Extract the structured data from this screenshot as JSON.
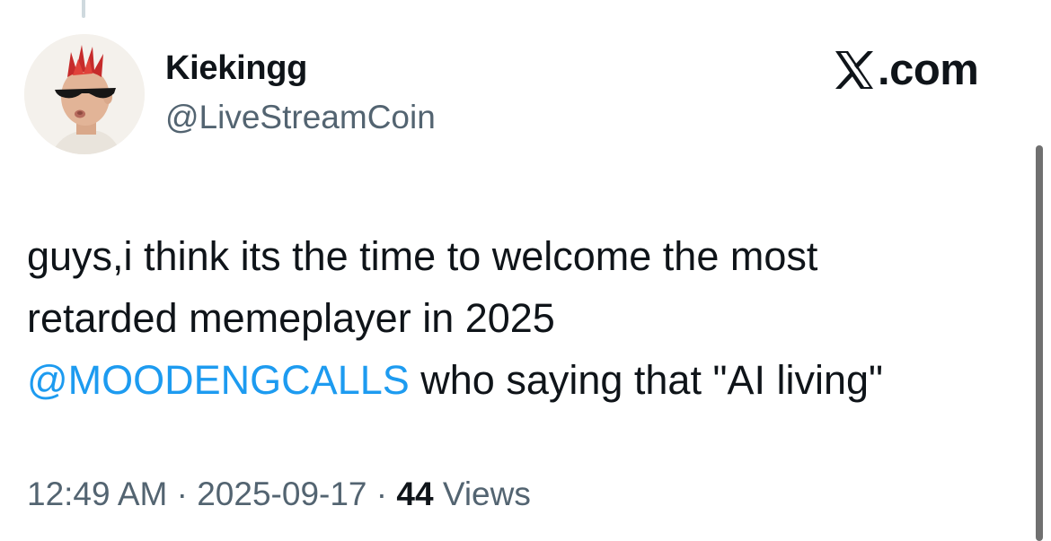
{
  "author": {
    "display_name": "Kiekingg",
    "handle": "@LiveStreamCoin"
  },
  "brand": {
    "icon": "x-logo-icon",
    "label": ".com"
  },
  "tweet": {
    "line1": "guys,i think its the time to welcome the most",
    "line2": "retarded memeplayer in 2025",
    "mention": "@MOODENGCALLS",
    "line3_rest": " who saying that \"AI living\""
  },
  "meta": {
    "time": "12:49 AM",
    "separator": " · ",
    "date": "2025-09-17",
    "views_count": "44",
    "views_label": " Views"
  },
  "colors": {
    "text": "#0f1419",
    "secondary": "#536471",
    "mention": "#1d9bf0",
    "background": "#ffffff"
  }
}
